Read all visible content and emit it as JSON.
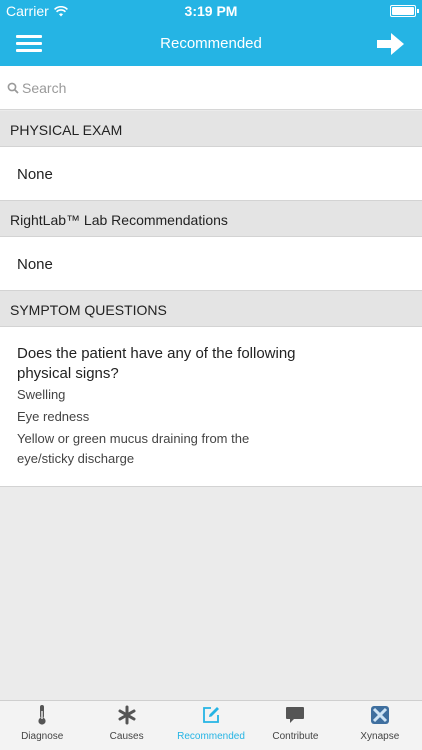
{
  "status_bar": {
    "carrier": "Carrier",
    "time": "3:19 PM"
  },
  "nav": {
    "title": "Recommended",
    "menu_icon": "hamburger-menu-icon",
    "forward_icon": "arrow-right-icon"
  },
  "search": {
    "placeholder": "Search",
    "value": ""
  },
  "sections": [
    {
      "header": "PHYSICAL EXAM",
      "content": "None"
    },
    {
      "header": "RightLab™ Lab Recommendations",
      "content": "None"
    },
    {
      "header": "SYMPTOM QUESTIONS",
      "question": "Does the patient have any of the following physical signs?",
      "options": [
        "Swelling",
        "Eye redness",
        "Yellow or green mucus draining from the eye/sticky discharge"
      ]
    }
  ],
  "tabs": [
    {
      "label": "Diagnose",
      "icon": "thermometer-icon",
      "active": false
    },
    {
      "label": "Causes",
      "icon": "asterisk-icon",
      "active": false
    },
    {
      "label": "Recommended",
      "icon": "edit-icon",
      "active": true
    },
    {
      "label": "Contribute",
      "icon": "speech-bubble-icon",
      "active": false
    },
    {
      "label": "Xynapse",
      "icon": "xynapse-logo-icon",
      "active": false
    }
  ],
  "colors": {
    "accent": "#25b4e4",
    "header_bg": "#e4e4e4",
    "background": "#ebebeb"
  }
}
